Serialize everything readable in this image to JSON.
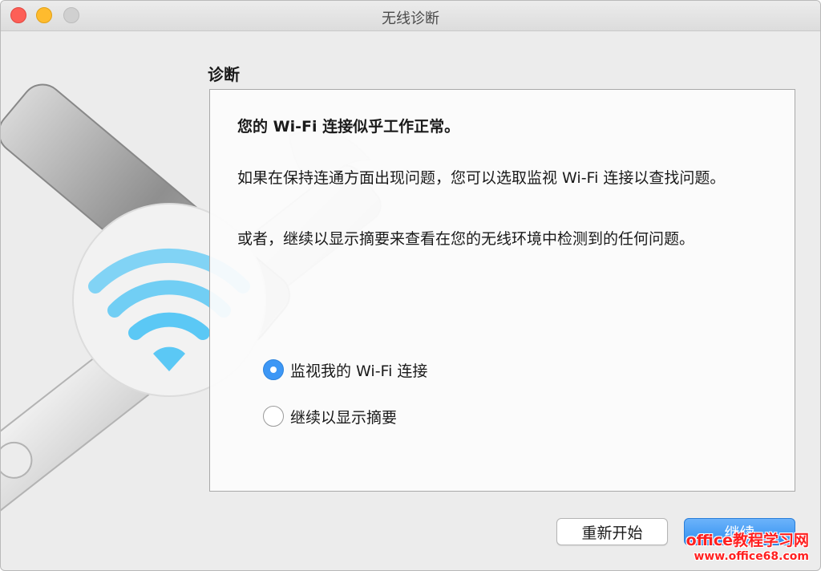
{
  "window": {
    "title": "无线诊断"
  },
  "illustration": {
    "icon": "wifi-on-wrench-icon",
    "accent_color": "#5bc8f5"
  },
  "main": {
    "section_title": "诊断",
    "status": "您的 Wi-Fi 连接似乎工作正常。",
    "paragraph1": "如果在保持连通方面出现问题，您可以选取监视 Wi-Fi 连接以查找问题。",
    "paragraph2": "或者，继续以显示摘要来查看在您的无线环境中检测到的任何问题。",
    "options": [
      {
        "label": "监视我的 Wi-Fi 连接",
        "selected": true
      },
      {
        "label": "继续以显示摘要",
        "selected": false
      }
    ]
  },
  "buttons": {
    "restart": "重新开始",
    "continue": "继续"
  },
  "watermark": {
    "brand": "office教程学习网",
    "url": "www.office68.com"
  },
  "colors": {
    "accent": "#3d97f5",
    "close": "#fd5f57",
    "minimize": "#febb2e"
  }
}
